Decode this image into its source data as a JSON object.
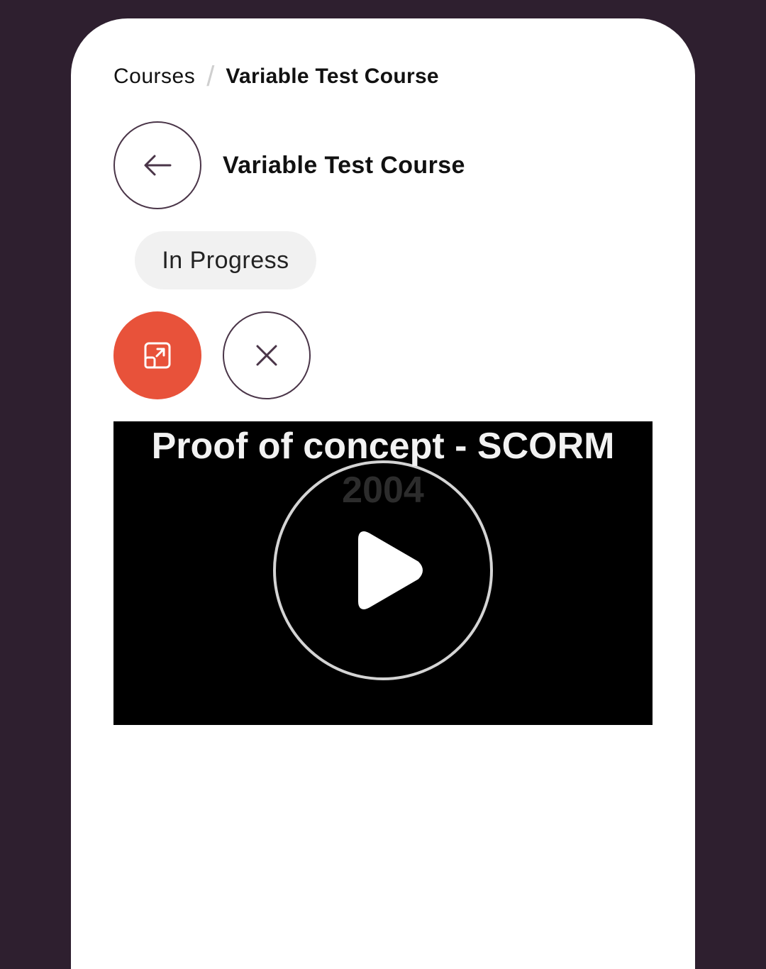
{
  "breadcrumb": {
    "root": "Courses",
    "separator": "/",
    "current": "Variable Test Course"
  },
  "header": {
    "back_icon": "arrow-left-icon",
    "title": "Variable Test Course"
  },
  "status": {
    "label": "In Progress"
  },
  "actions": {
    "launch_icon": "open-external-icon",
    "close_icon": "close-icon"
  },
  "player": {
    "title_line1": "Proof of concept - SCORM",
    "title_line2": "2004",
    "play_icon": "play-icon"
  },
  "colors": {
    "page_background": "#2e1f2f",
    "card_background": "#ffffff",
    "accent": "#e8523a",
    "outline": "#4a3548",
    "badge_background": "#f1f1f1",
    "player_background": "#000000"
  }
}
